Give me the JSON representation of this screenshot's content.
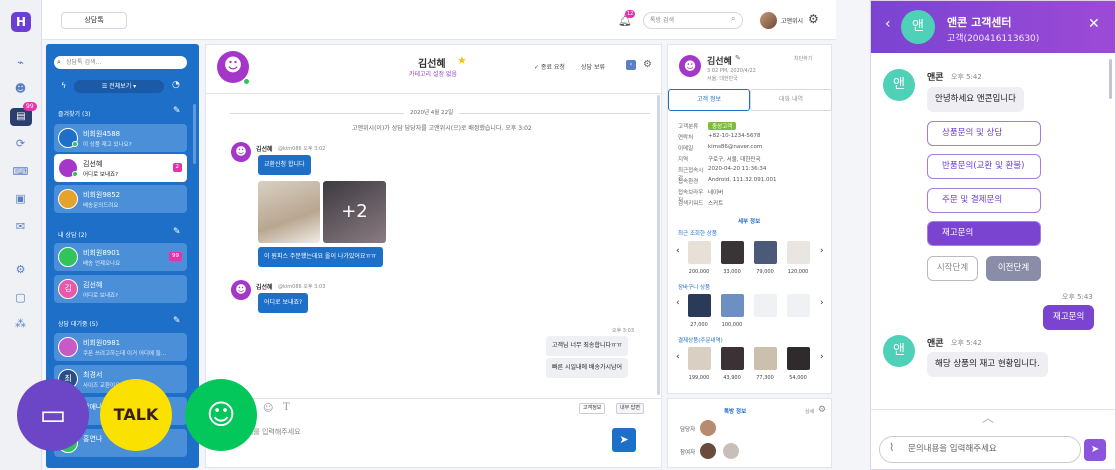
{
  "brand": {
    "accent": "#1e6fc8",
    "purple": "#7a44d1",
    "mint": "#4fd1b8",
    "pink": "#e236a8"
  },
  "rail": {
    "logo": "H",
    "badge": "99",
    "icons": [
      "chart-icon",
      "users-icon",
      "chat-icon",
      "sync-icon",
      "keyboard-icon",
      "screen-icon",
      "mail-icon",
      "settings-icon",
      "profile-icon",
      "network-icon"
    ]
  },
  "topbar": {
    "tab": "상담톡",
    "notif_badge": "12",
    "search_placeholder": "톡방 검색",
    "user": "고앤위시"
  },
  "list": {
    "search_placeholder": "상담톡 검색...",
    "filter": "☰ 전체보기 ▾",
    "sections": [
      {
        "title": "즐겨찾기 (3)"
      },
      {
        "title": "내 상담 (2)"
      },
      {
        "title": "상담 대기중 (5)"
      }
    ],
    "fav": [
      {
        "name": "비회원4588",
        "msg": "이 상품 재고 있나요?",
        "badge": ""
      },
      {
        "name": "김선혜",
        "msg": "어디로 보내죠?",
        "badge": "2"
      },
      {
        "name": "비회원9852",
        "msg": "배송문의드려요",
        "badge": ""
      }
    ],
    "mine": [
      {
        "name": "비회원8901",
        "msg": "배송 언제오나요",
        "badge": "99"
      },
      {
        "name": "김선혜",
        "msg": "어디로 보내죠?",
        "badge": "",
        "initial": "김"
      }
    ],
    "wait": [
      {
        "name": "비회원0981",
        "msg": "쿠폰 쓰려고하는데 이거 어디에 들...",
        "badge": ""
      },
      {
        "name": "최경서",
        "msg": "사이즈 교환이요",
        "initial": "최",
        "badge": ""
      },
      {
        "name": "장애나",
        "msg": "",
        "badge": ""
      },
      {
        "name": "홍연나",
        "msg": "",
        "badge": ""
      }
    ]
  },
  "chat": {
    "name": "김선혜",
    "category": "카테고리 설정 없음",
    "btn_end": "✓ 종료 요청",
    "btn_hold": "상담 보류",
    "date": "2020년 4월 22일",
    "system": "고앤위시(이)가 상담 담당자를 고앤위시(으)로 배정했습니다. 오후 3:02",
    "msg1_name": "김선혜",
    "msg1_meta": "@kim086 오후 3:02",
    "msg1_text": "교환신청 합니다",
    "photo_more": "+2",
    "msg2_text": "이 원피스 주문했는데요 올이 나가있어요ㅠㅠ",
    "msg3_name": "김선혜",
    "msg3_meta": "@kim086 오후 3:03",
    "msg3_text": "어디로 보내죠?",
    "agent_time": "오후 3:03",
    "agent_text1": "고객님 너무 죄송합니다ㅠㅠ",
    "agent_text2": "빠른 시일내에 배송가시남어",
    "composer_placeholder": "메시지를 입력해주세요",
    "btn_cust": "고객정보",
    "btn_internal": "내부 답변"
  },
  "info": {
    "name": "김선혜",
    "sub1": "3 02 PM, 2020/4/22",
    "sub2": "서울, 대한민국",
    "block": "차단하기",
    "tab_customer": "고객 정보",
    "tab_history": "대화 내역",
    "rows": [
      {
        "k": "고객분류",
        "v": "충성고객"
      },
      {
        "k": "연락처",
        "v": "+82-10-1234-5678"
      },
      {
        "k": "이메일",
        "v": "kims86@naver.com"
      },
      {
        "k": "지역",
        "v": "구로구, 서울, 대한민국"
      },
      {
        "k": "최근접속시간",
        "v": "2020-04-20 11:36:34"
      },
      {
        "k": "접속환경",
        "v": "Android, 111.32.091.001"
      },
      {
        "k": "접속브라우저",
        "v": "네이버"
      },
      {
        "k": "검색키워드",
        "v": "스커트"
      }
    ],
    "detail_head": "세부 정보",
    "recent_label": "최근 조회한 상품",
    "recent_prices": [
      "200,000",
      "33,000",
      "79,000",
      "120,000"
    ],
    "cart_label": "장바구니 상품",
    "cart_prices": [
      "27,000",
      "100,000"
    ],
    "order_label": "결제상품(주문내역)",
    "order_prices": [
      "199,000",
      "43,900",
      "77,300",
      "54,000"
    ],
    "special_head": "톡방 정보",
    "special_more": "상세",
    "assignee": "담당자",
    "participants": "참여자"
  },
  "widget": {
    "logo": "앤",
    "title": "앤콘 고객센터",
    "sub": "고객(200416113630)",
    "bot": "앤콘",
    "time1": "오후 5:42",
    "greet": "안녕하세요 앤콘입니다",
    "options": [
      "상품문의 및 상담",
      "반품문의(교환 및 환불)",
      "주문 및 결제문의",
      "재고문의"
    ],
    "btn_start": "시작단계",
    "btn_prev": "이전단계",
    "my_time": "오후 5:43",
    "my_msg": "재고문의",
    "bot2": "앤콘",
    "time2": "오후 5:42",
    "reply": "해당 상품의 재고 현황입니다.",
    "input_placeholder": "문의내용을 입력해주세요"
  },
  "float": {
    "talk": "TALK"
  }
}
